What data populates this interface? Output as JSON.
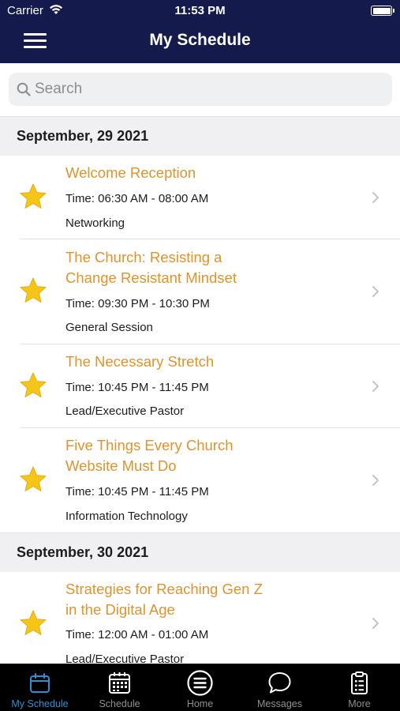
{
  "status_bar": {
    "carrier": "Carrier",
    "time": "11:53 PM"
  },
  "nav": {
    "title": "My Schedule"
  },
  "search": {
    "placeholder": "Search"
  },
  "sections": [
    {
      "date": "September, 29 2021"
    },
    {
      "date": "September, 30 2021"
    }
  ],
  "sessions": [
    {
      "title": "Welcome Reception",
      "time": "Time: 06:30 AM - 08:00 AM",
      "track": "Networking"
    },
    {
      "title_line1": "The Church: Resisting a",
      "title_line2": "Change Resistant Mindset",
      "time": "Time: 09:30 PM - 10:30 PM",
      "track": "General Session"
    },
    {
      "title": "The Necessary Stretch",
      "time": "Time: 10:45 PM - 11:45 PM",
      "track": "Lead/Executive Pastor"
    },
    {
      "title_line1": "Five Things Every Church",
      "title_line2": "Website Must Do",
      "time": "Time: 10:45 PM - 11:45 PM",
      "track": "Information Technology"
    },
    {
      "title_line1": "Strategies for Reaching Gen Z",
      "title_line2": "in the Digital Age",
      "time": "Time: 12:00 AM - 01:00 AM",
      "track": "Lead/Executive Pastor"
    }
  ],
  "tabs": [
    {
      "label": "My Schedule",
      "icon": "calendar-icon",
      "active": true
    },
    {
      "label": "Schedule",
      "icon": "calendar-grid-icon",
      "active": false
    },
    {
      "label": "Home",
      "icon": "home-menu-icon",
      "active": false
    },
    {
      "label": "Messages",
      "icon": "chat-bubble-icon",
      "active": false
    },
    {
      "label": "More",
      "icon": "clipboard-icon",
      "active": false
    }
  ],
  "colors": {
    "nav_bg": "#151a4d",
    "title_orange": "#e0932b",
    "star_gold": "#f5c518",
    "tab_active": "#2d8fd6",
    "tab_inactive": "#8e8e93"
  }
}
